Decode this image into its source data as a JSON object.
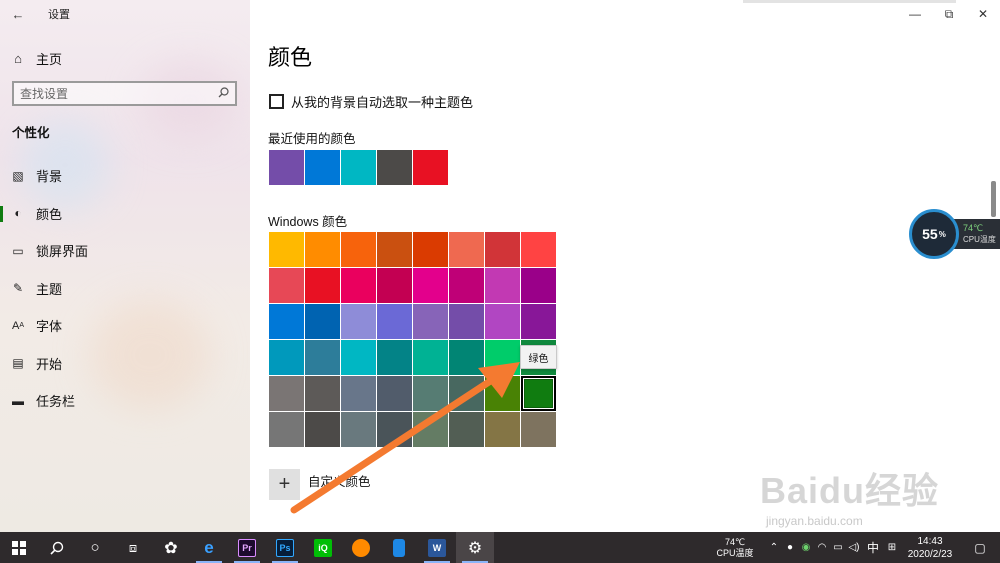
{
  "window": {
    "title": "设置",
    "back_icon": "arrow-left-icon"
  },
  "sidebar": {
    "home_label": "主页",
    "search_placeholder": "查找设置",
    "section_title": "个性化",
    "items": [
      {
        "label": "背景",
        "icon": "picture-icon",
        "active": false
      },
      {
        "label": "颜色",
        "icon": "palette-icon",
        "active": true
      },
      {
        "label": "锁屏界面",
        "icon": "lock-screen-icon",
        "active": false
      },
      {
        "label": "主题",
        "icon": "brush-icon",
        "active": false
      },
      {
        "label": "字体",
        "icon": "font-icon",
        "active": false
      },
      {
        "label": "开始",
        "icon": "start-icon",
        "active": false
      },
      {
        "label": "任务栏",
        "icon": "taskbar-icon",
        "active": false
      }
    ]
  },
  "main": {
    "title": "颜色",
    "auto_pick_label": "从我的背景自动选取一种主题色",
    "auto_pick_checked": false,
    "recent_heading": "最近使用的颜色",
    "recent_colors": [
      "#744da9",
      "#0078d7",
      "#00b7c3",
      "#4c4a48",
      "#e81123"
    ],
    "windows_heading": "Windows 颜色",
    "windows_colors": [
      [
        "#ffb900",
        "#ff8c00",
        "#f7630c",
        "#ca5010",
        "#da3b01",
        "#ef6950",
        "#d13438",
        "#ff4343"
      ],
      [
        "#e74856",
        "#e81123",
        "#ea005e",
        "#c30052",
        "#e3008c",
        "#bf0077",
        "#c239b3",
        "#9a0089"
      ],
      [
        "#0078d7",
        "#0063b1",
        "#8e8cd8",
        "#6b69d6",
        "#8764b8",
        "#744da9",
        "#b146c2",
        "#881798"
      ],
      [
        "#0099bc",
        "#2d7d9a",
        "#00b7c3",
        "#038387",
        "#00b294",
        "#018574",
        "#00cc6a",
        "#10893e"
      ],
      [
        "#7a7574",
        "#5d5a58",
        "#68768a",
        "#515c6b",
        "#567c73",
        "#486860",
        "#498205",
        "#107c10"
      ],
      [
        "#767676",
        "#4c4a48",
        "#69797e",
        "#4a5459",
        "#647c64",
        "#525e54",
        "#847545",
        "#7e735f"
      ]
    ],
    "selected_color": "#107c10",
    "tooltip_text": "绿色",
    "custom_label": "自定义颜色"
  },
  "cpu_widget": {
    "percent": "55",
    "percent_sign": "%",
    "temp": "74℃",
    "label": "CPU温度"
  },
  "watermark": {
    "brand": "Baidu经验",
    "url": "jingyan.baidu.com"
  },
  "taskbar": {
    "cpu_temp": "74℃",
    "cpu_label": "CPU温度",
    "ime": "中",
    "time": "14:43",
    "date": "2020/2/23",
    "apps": [
      {
        "icon": "windows-start-icon"
      },
      {
        "icon": "search-icon"
      },
      {
        "icon": "cortana-icon"
      },
      {
        "icon": "task-view-icon"
      },
      {
        "icon": "pinwheel-app-icon"
      },
      {
        "icon": "ie-browser-icon"
      },
      {
        "icon": "premiere-icon",
        "text": "Pr"
      },
      {
        "icon": "photoshop-icon",
        "text": "Ps"
      },
      {
        "icon": "iqiyi-icon",
        "text": "iQ"
      },
      {
        "icon": "uc-browser-icon"
      },
      {
        "icon": "phone-icon"
      },
      {
        "icon": "word-icon",
        "text": "W"
      },
      {
        "icon": "settings-gear-icon"
      }
    ]
  }
}
